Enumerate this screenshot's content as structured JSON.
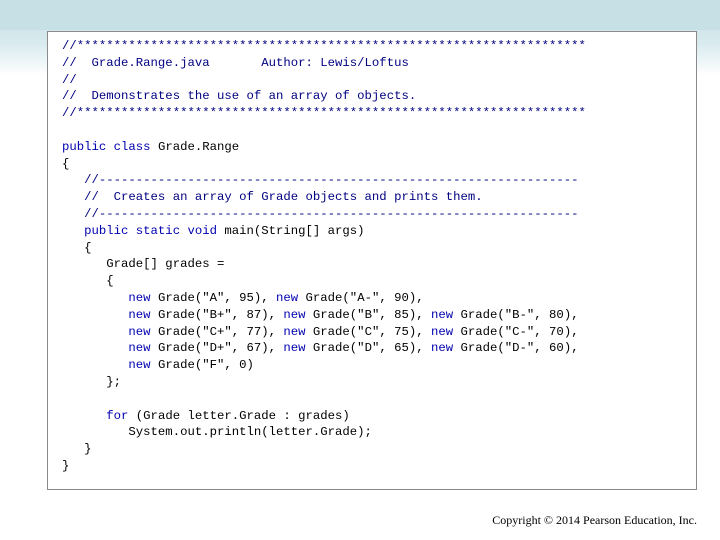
{
  "code": {
    "lines": [
      [
        {
          "t": "//*********************************************************************",
          "c": "cm"
        }
      ],
      [
        {
          "t": "//  Grade.Range.java       Author: Lewis/Loftus",
          "c": "cm"
        }
      ],
      [
        {
          "t": "//",
          "c": "cm"
        }
      ],
      [
        {
          "t": "//  Demonstrates the use of an array of objects.",
          "c": "cm"
        }
      ],
      [
        {
          "t": "//*********************************************************************",
          "c": "cm"
        }
      ],
      [
        {
          "t": "",
          "c": ""
        }
      ],
      [
        {
          "t": "public class",
          "c": "kw"
        },
        {
          "t": " Grade.Range",
          "c": ""
        }
      ],
      [
        {
          "t": "{",
          "c": ""
        }
      ],
      [
        {
          "t": "   //-----------------------------------------------------------------",
          "c": "cm"
        }
      ],
      [
        {
          "t": "   //  Creates an array of Grade objects and prints them.",
          "c": "cm"
        }
      ],
      [
        {
          "t": "   //-----------------------------------------------------------------",
          "c": "cm"
        }
      ],
      [
        {
          "t": "   public static void",
          "c": "kw"
        },
        {
          "t": " main(String[] args)",
          "c": ""
        }
      ],
      [
        {
          "t": "   {",
          "c": ""
        }
      ],
      [
        {
          "t": "      Grade[] grades =",
          "c": ""
        }
      ],
      [
        {
          "t": "      {",
          "c": ""
        }
      ],
      [
        {
          "t": "         new",
          "c": "kw"
        },
        {
          "t": " Grade(\"A\", 95), ",
          "c": ""
        },
        {
          "t": "new",
          "c": "kw"
        },
        {
          "t": " Grade(\"A-\", 90),",
          "c": ""
        }
      ],
      [
        {
          "t": "         new",
          "c": "kw"
        },
        {
          "t": " Grade(\"B+\", 87), ",
          "c": ""
        },
        {
          "t": "new",
          "c": "kw"
        },
        {
          "t": " Grade(\"B\", 85), ",
          "c": ""
        },
        {
          "t": "new",
          "c": "kw"
        },
        {
          "t": " Grade(\"B-\", 80),",
          "c": ""
        }
      ],
      [
        {
          "t": "         new",
          "c": "kw"
        },
        {
          "t": " Grade(\"C+\", 77), ",
          "c": ""
        },
        {
          "t": "new",
          "c": "kw"
        },
        {
          "t": " Grade(\"C\", 75), ",
          "c": ""
        },
        {
          "t": "new",
          "c": "kw"
        },
        {
          "t": " Grade(\"C-\", 70),",
          "c": ""
        }
      ],
      [
        {
          "t": "         new",
          "c": "kw"
        },
        {
          "t": " Grade(\"D+\", 67), ",
          "c": ""
        },
        {
          "t": "new",
          "c": "kw"
        },
        {
          "t": " Grade(\"D\", 65), ",
          "c": ""
        },
        {
          "t": "new",
          "c": "kw"
        },
        {
          "t": " Grade(\"D-\", 60),",
          "c": ""
        }
      ],
      [
        {
          "t": "         new",
          "c": "kw"
        },
        {
          "t": " Grade(\"F\", 0)",
          "c": ""
        }
      ],
      [
        {
          "t": "      };",
          "c": ""
        }
      ],
      [
        {
          "t": "",
          "c": ""
        }
      ],
      [
        {
          "t": "      for",
          "c": "kw"
        },
        {
          "t": " (Grade letter.Grade : grades)",
          "c": ""
        }
      ],
      [
        {
          "t": "         System.out.println(letter.Grade);",
          "c": ""
        }
      ],
      [
        {
          "t": "   }",
          "c": ""
        }
      ],
      [
        {
          "t": "}",
          "c": ""
        }
      ]
    ]
  },
  "footer": {
    "copyright": "Copyright © 2014 Pearson Education, Inc."
  },
  "colors": {
    "comment": "#000080",
    "keyword": "#0000b0",
    "band": "#c6e0e6"
  }
}
